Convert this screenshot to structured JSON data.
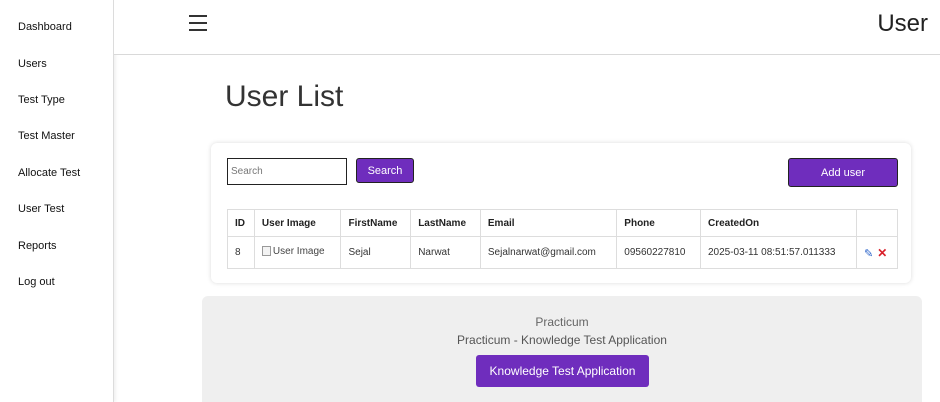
{
  "sidebar": {
    "items": [
      {
        "label": "Dashboard"
      },
      {
        "label": "Users"
      },
      {
        "label": "Test Type"
      },
      {
        "label": "Test Master"
      },
      {
        "label": "Allocate Test"
      },
      {
        "label": "User Test"
      },
      {
        "label": "Reports"
      },
      {
        "label": "Log out"
      }
    ]
  },
  "header": {
    "menu_icon": "hamburger-icon",
    "title": "User"
  },
  "main": {
    "page_title": "User List",
    "search": {
      "placeholder": "Search",
      "value": "",
      "button_label": "Search"
    },
    "add_button_label": "Add user",
    "table": {
      "columns": [
        "ID",
        "User Image",
        "FirstName",
        "LastName",
        "Email",
        "Phone",
        "CreatedOn",
        ""
      ],
      "rows": [
        {
          "id": "8",
          "image_alt": "User Image",
          "first_name": "Sejal",
          "last_name": "Narwat",
          "email": "Sejalnarwat@gmail.com",
          "phone": "09560227810",
          "created_on": "2025-03-11 08:51:57.011333",
          "actions": {
            "edit_icon": "pencil-icon",
            "delete_icon": "close-icon"
          }
        }
      ]
    }
  },
  "footer": {
    "line1": "Practicum",
    "line2": "Practicum - Knowledge Test Application",
    "button_label": "Knowledge Test Application"
  },
  "colors": {
    "accent": "#6f2dbd",
    "edit_icon": "#2a63c9",
    "delete_icon": "#d9202a"
  }
}
